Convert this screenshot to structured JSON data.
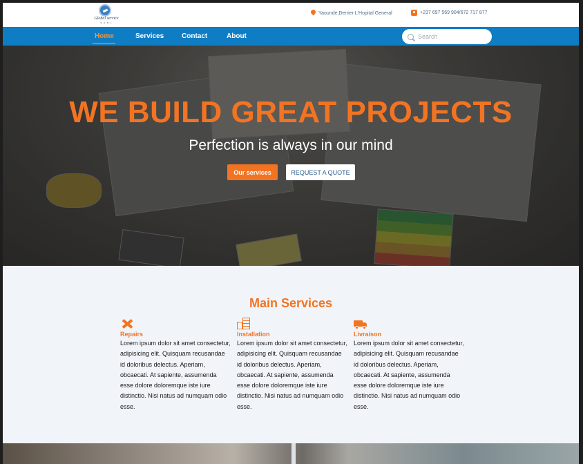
{
  "header": {
    "logo_brand": "Global service",
    "logo_sub": "S.A.R.L",
    "address": "Yaounde,Derrier L'Hopital General",
    "phone": "+237 697 569 904/672 717 877"
  },
  "nav": {
    "items": [
      {
        "label": "Home",
        "active": true
      },
      {
        "label": "Services",
        "active": false
      },
      {
        "label": "Contact",
        "active": false
      },
      {
        "label": "About",
        "active": false
      }
    ],
    "search_placeholder": "Search"
  },
  "hero": {
    "title": "WE BUILD GREAT PROJECTS",
    "subtitle": "Perfection is always in our mind",
    "primary_button": "Our services",
    "secondary_button": "REQUEST A QUOTE"
  },
  "services": {
    "heading": "Main Services",
    "items": [
      {
        "icon": "tools-icon",
        "title": "Repairs",
        "text": "Lorem ipsum dolor sit amet consectetur, adipisicing elit. Quisquam recusandae id doloribus delectus. Aperiam, obcaecati. At sapiente, assumenda esse dolore doloremque iste iure distinctio. Nisi natus ad numquam odio esse."
      },
      {
        "icon": "building-icon",
        "title": "Installation",
        "text": "Lorem ipsum dolor sit amet consectetur, adipisicing elit. Quisquam recusandae id doloribus delectus. Aperiam, obcaecati. At sapiente, assumenda esse dolore doloremque iste iure distinctio. Nisi natus ad numquam odio esse."
      },
      {
        "icon": "truck-icon",
        "title": "Livraison",
        "text": "Lorem ipsum dolor sit amet consectetur, adipisicing elit. Quisquam recusandae id doloribus delectus. Aperiam, obcaecati. At sapiente, assumenda esse dolore doloremque iste iure distinctio. Nisi natus ad numquam odio esse."
      }
    ]
  },
  "colors": {
    "accent": "#f27423",
    "nav": "#0f7dc4",
    "section_bg": "#f1f4f8"
  }
}
